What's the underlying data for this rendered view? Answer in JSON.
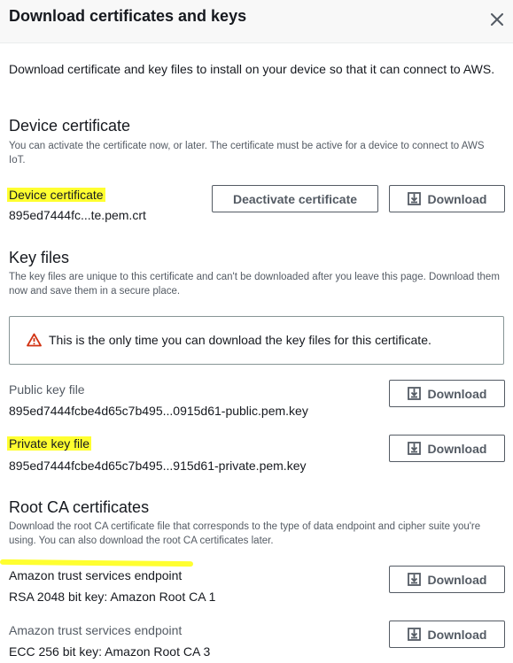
{
  "dialog": {
    "title": "Download certificates and keys",
    "intro": "Download certificate and key files to install on your device so that it can connect to AWS."
  },
  "device_certificate": {
    "heading": "Device certificate",
    "description": "You can activate the certificate now, or later. The certificate must be active for a device to connect to AWS IoT.",
    "label": "Device certificate",
    "filename": "895ed7444fc...te.pem.crt",
    "deactivate_label": "Deactivate certificate",
    "download_label": "Download"
  },
  "key_files": {
    "heading": "Key files",
    "description": "The key files are unique to this certificate and can't be downloaded after you leave this page. Download them now and save them in a secure place.",
    "alert": "This is the only time you can download the key files for this certificate.",
    "public": {
      "label": "Public key file",
      "filename": "895ed7444fcbe4d65c7b495...0915d61-public.pem.key",
      "download_label": "Download"
    },
    "private": {
      "label": "Private key file",
      "filename": "895ed7444fcbe4d65c7b495...915d61-private.pem.key",
      "download_label": "Download"
    }
  },
  "root_ca": {
    "heading": "Root CA certificates",
    "description": "Download the root CA certificate file that corresponds to the type of data endpoint and cipher suite you're using. You can also download the root CA certificates later.",
    "items": [
      {
        "label": "Amazon trust services endpoint",
        "value": "RSA 2048 bit key: Amazon Root CA 1",
        "download_label": "Download"
      },
      {
        "label": "Amazon trust services endpoint",
        "value": "ECC 256 bit key: Amazon Root CA 3",
        "download_label": "Download"
      }
    ]
  },
  "colors": {
    "highlight": "#ffff30",
    "warning": "#d13212",
    "text": "#16191f",
    "secondary_text": "#545b64"
  },
  "icons": {
    "close": "close-icon",
    "download": "download-icon",
    "warning": "warning-icon"
  }
}
